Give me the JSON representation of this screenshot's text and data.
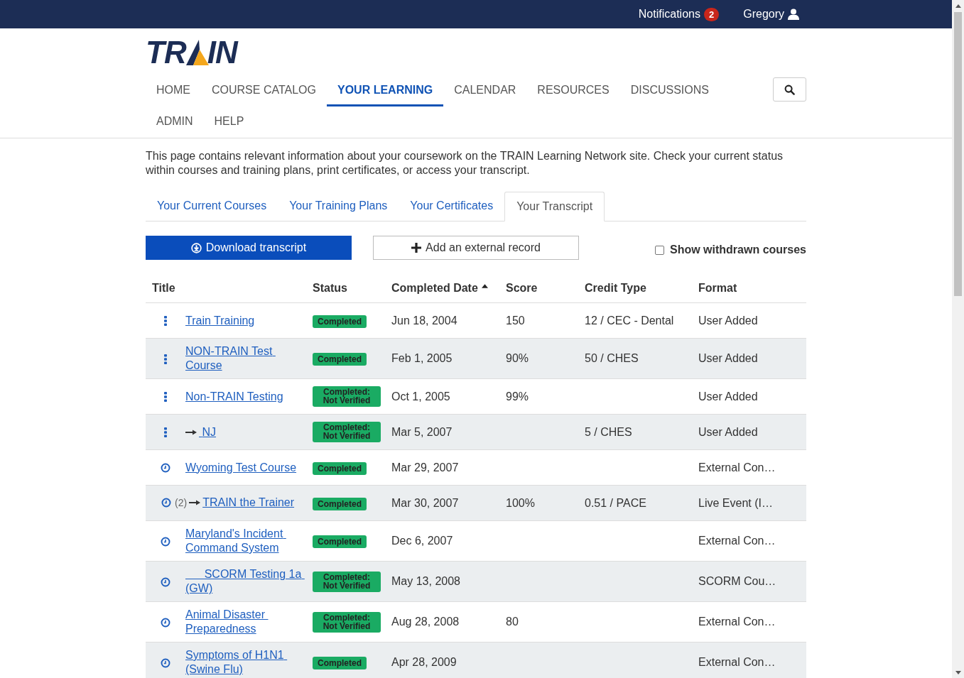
{
  "topbar": {
    "notifications": {
      "label": "Notifications",
      "count": "2"
    },
    "user": "Gregory"
  },
  "logo": {
    "left": "TR",
    "right": "IN"
  },
  "nav": [
    {
      "label": "HOME",
      "selected": false
    },
    {
      "label": "COURSE CATALOG",
      "selected": false
    },
    {
      "label": "YOUR LEARNING",
      "selected": true
    },
    {
      "label": "CALENDAR",
      "selected": false
    },
    {
      "label": "RESOURCES",
      "selected": false
    },
    {
      "label": "DISCUSSIONS",
      "selected": false
    },
    {
      "label": "ADMIN",
      "selected": false
    },
    {
      "label": "HELP",
      "selected": false
    }
  ],
  "intro": "This page contains relevant information about your coursework on the TRAIN Learning Network site. Check your current status within courses and training plans, print certificates, or access your transcript.",
  "tabs": [
    {
      "label": "Your Current Courses",
      "selected": false
    },
    {
      "label": "Your Training Plans",
      "selected": false
    },
    {
      "label": "Your Certificates",
      "selected": false
    },
    {
      "label": "Your Transcript",
      "selected": true
    }
  ],
  "actions": {
    "download": "Download transcript",
    "add": "Add an external record",
    "withdrawn": {
      "label": "Show withdrawn courses",
      "checked": false
    }
  },
  "table": {
    "columns": [
      {
        "label": "Title",
        "sorted": false
      },
      {
        "label": "Status",
        "sorted": false
      },
      {
        "label": "Completed Date",
        "sorted": true
      },
      {
        "label": "Score",
        "sorted": false
      },
      {
        "label": "Credit Type",
        "sorted": false
      },
      {
        "label": "Format",
        "sorted": false
      }
    ],
    "rows": [
      {
        "kind": "menu",
        "title": "Train Training",
        "status": "Completed",
        "verified": true,
        "date": "Jun 18, 2004",
        "score": "150",
        "credit": "12 / CEC - Dental",
        "format": "User Added"
      },
      {
        "kind": "menu",
        "title": "NON-TRAIN Test Course",
        "status": "Completed",
        "verified": true,
        "date": "Feb 1, 2005",
        "score": "90%",
        "credit": "50 / CHES",
        "format": "User Added"
      },
      {
        "kind": "menu",
        "title": "Non-TRAIN Testing",
        "status": "Completed: Not Verified",
        "verified": false,
        "date": "Oct 1, 2005",
        "score": "99%",
        "format": "User Added"
      },
      {
        "kind": "menu",
        "linked": true,
        "title": " NJ",
        "status": "Completed: Not Verified",
        "verified": false,
        "date": "Mar 5, 2007",
        "credit": "5 / CHES",
        "format": "User Added"
      },
      {
        "kind": "clock",
        "title": "Wyoming Test Course",
        "status": "Completed",
        "verified": true,
        "date": "Mar 29, 2007",
        "format": "External Con…"
      },
      {
        "kind": "clock",
        "count": "(2)",
        "linked": true,
        "title": "TRAIN the Trainer",
        "status": "Completed",
        "verified": true,
        "date": "Mar 30, 2007",
        "score": "100%",
        "credit": "0.51 / PACE",
        "format": "Live Event (I…"
      },
      {
        "kind": "clock",
        "title": "Maryland's Incident Command System",
        "status": "Completed",
        "verified": true,
        "date": "Dec 6, 2007",
        "format": "External Con…"
      },
      {
        "kind": "clock",
        "title": "      SCORM Testing 1a (GW)",
        "status": "Completed: Not Verified",
        "verified": false,
        "date": "May 13, 2008",
        "format": "SCORM Cou…"
      },
      {
        "kind": "clock",
        "title": "Animal Disaster Preparedness",
        "status": "Completed: Not Verified",
        "verified": false,
        "date": "Aug 28, 2008",
        "score": "80",
        "format": "External Con…"
      },
      {
        "kind": "clock",
        "title": "Symptoms of H1N1 (Swine Flu)",
        "status": "Completed",
        "verified": true,
        "date": "Apr 28, 2009",
        "format": "External Con…"
      }
    ]
  }
}
